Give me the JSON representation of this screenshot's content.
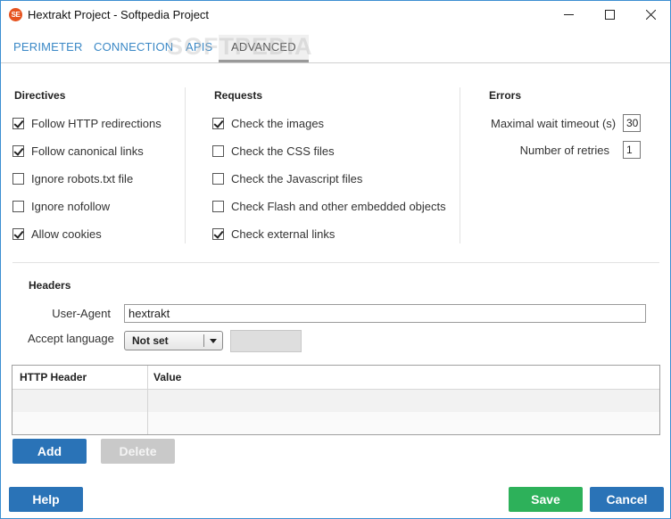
{
  "window": {
    "app_icon_text": "SE",
    "title": "Hextrakt Project - Softpedia Project"
  },
  "tabs": [
    {
      "label": "PERIMETER"
    },
    {
      "label": "CONNECTION"
    },
    {
      "label": "APIS"
    },
    {
      "label": "ADVANCED",
      "active": true
    }
  ],
  "watermark": "SOFTPEDIA",
  "directives": {
    "title": "Directives",
    "items": [
      {
        "label": "Follow HTTP redirections",
        "checked": true
      },
      {
        "label": "Follow canonical links",
        "checked": true
      },
      {
        "label": "Ignore robots.txt file",
        "checked": false
      },
      {
        "label": "Ignore nofollow",
        "checked": false
      },
      {
        "label": "Allow cookies",
        "checked": true
      }
    ]
  },
  "requests": {
    "title": "Requests",
    "items": [
      {
        "label": "Check the images",
        "checked": true
      },
      {
        "label": "Check the CSS files",
        "checked": false
      },
      {
        "label": "Check the Javascript files",
        "checked": false
      },
      {
        "label": "Check Flash and other embedded objects",
        "checked": false
      },
      {
        "label": "Check external links",
        "checked": true
      }
    ]
  },
  "errors": {
    "title": "Errors",
    "max_wait_label": "Maximal wait timeout (s)",
    "max_wait_value": "30",
    "retries_label": "Number of retries",
    "retries_value": "1"
  },
  "headers": {
    "title": "Headers",
    "user_agent_label": "User-Agent",
    "user_agent_value": "hextrakt",
    "accept_language_label": "Accept language",
    "accept_language_value": "Not set",
    "grid": {
      "columns": [
        "HTTP Header",
        "Value"
      ],
      "rows": []
    },
    "add_label": "Add",
    "delete_label": "Delete"
  },
  "footer": {
    "help_label": "Help",
    "save_label": "Save",
    "cancel_label": "Cancel"
  },
  "colors": {
    "accent": "#2a73b7",
    "save": "#2db15a",
    "tab_link": "#3a88c6",
    "window_border": "#3c8fd1"
  }
}
